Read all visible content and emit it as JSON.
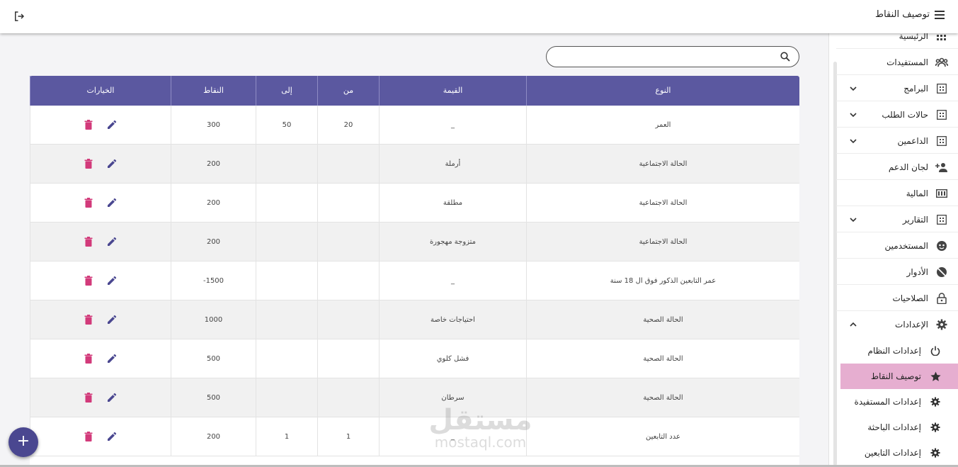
{
  "header": {
    "title": "توصيف النقاط"
  },
  "sidebar": {
    "items": [
      {
        "label": "الرئيسية",
        "icon": "grid-icon"
      },
      {
        "label": "المستفيدات",
        "icon": "group-icon"
      },
      {
        "label": "البرامج",
        "icon": "dashboard-icon"
      },
      {
        "label": "حالات الطلب",
        "icon": "dashboard-icon"
      },
      {
        "label": "الداعمين",
        "icon": "dashboard-icon"
      },
      {
        "label": "لجان الدعم",
        "icon": "add-person-icon"
      },
      {
        "label": "المالية",
        "icon": "money-icon"
      },
      {
        "label": "التقارير",
        "icon": "dashboard-icon"
      },
      {
        "label": "المستخدمين",
        "icon": "face-icon"
      },
      {
        "label": "الأدوار",
        "icon": "blocked-icon"
      },
      {
        "label": "الصلاحيات",
        "icon": "lock-icon"
      },
      {
        "label": "الإعدادات",
        "icon": "gear-icon"
      }
    ],
    "subitems": [
      {
        "label": "إعدادات النظام",
        "icon": "power-icon"
      },
      {
        "label": "توصيف النقاط",
        "icon": "star-icon"
      },
      {
        "label": "إعدادات المستفيدة",
        "icon": "gear-icon"
      },
      {
        "label": "إعدادات الباحثة",
        "icon": "gear-icon"
      },
      {
        "label": "إعدادات التابعين",
        "icon": "gear-icon"
      }
    ]
  },
  "search": {
    "placeholder": ""
  },
  "table": {
    "headers": [
      "النوع",
      "القيمة",
      "من",
      "إلى",
      "النقاط",
      "الخيارات"
    ],
    "rows": [
      {
        "type": "العمر",
        "value": "_",
        "from": "20",
        "to": "50",
        "points": "300"
      },
      {
        "type": "الحالة الاجتماعية",
        "value": "أرملة",
        "from": "",
        "to": "",
        "points": "200"
      },
      {
        "type": "الحالة الاجتماعية",
        "value": "مطلقة",
        "from": "",
        "to": "",
        "points": "200"
      },
      {
        "type": "الحالة الاجتماعية",
        "value": "متزوجة مهجورة",
        "from": "",
        "to": "",
        "points": "200"
      },
      {
        "type": "عمر التابعين الذكور فوق ال 18 سنة",
        "value": "_",
        "from": "",
        "to": "",
        "points": "1500-"
      },
      {
        "type": "الحالة الصحية",
        "value": "احتياجات خاصة",
        "from": "",
        "to": "",
        "points": "1000"
      },
      {
        "type": "الحالة الصحية",
        "value": "فشل كلوي",
        "from": "",
        "to": "",
        "points": "500"
      },
      {
        "type": "الحالة الصحية",
        "value": "سرطان",
        "from": "",
        "to": "",
        "points": "500"
      },
      {
        "type": "عدد التابعين",
        "value": "_",
        "from": "1",
        "to": "1",
        "points": "200"
      }
    ]
  },
  "watermark": {
    "ar": "مستقل",
    "en": "mostaql.com"
  },
  "fab": {
    "label": "+"
  },
  "colors": {
    "header": "#5b58a0",
    "accent": "#4a4790",
    "delete": "#d23a7a",
    "active": "#e6aed0"
  }
}
